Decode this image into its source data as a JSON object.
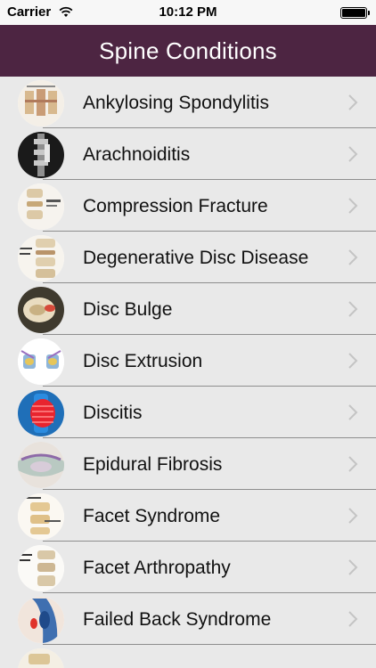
{
  "status_bar": {
    "carrier": "Carrier",
    "time": "10:12 PM",
    "icons": [
      "wifi-icon",
      "battery-icon"
    ]
  },
  "nav": {
    "title": "Spine Conditions",
    "background": "#4d2542"
  },
  "list": {
    "items": [
      {
        "label": "Ankylosing Spondylitis",
        "icon": "ankylosing-spondylitis-thumbnail"
      },
      {
        "label": "Arachnoiditis",
        "icon": "arachnoiditis-thumbnail"
      },
      {
        "label": "Compression Fracture",
        "icon": "compression-fracture-thumbnail"
      },
      {
        "label": "Degenerative Disc Disease",
        "icon": "degenerative-disc-disease-thumbnail"
      },
      {
        "label": "Disc Bulge",
        "icon": "disc-bulge-thumbnail"
      },
      {
        "label": "Disc Extrusion",
        "icon": "disc-extrusion-thumbnail"
      },
      {
        "label": "Discitis",
        "icon": "discitis-thumbnail"
      },
      {
        "label": "Epidural Fibrosis",
        "icon": "epidural-fibrosis-thumbnail"
      },
      {
        "label": "Facet Syndrome",
        "icon": "facet-syndrome-thumbnail"
      },
      {
        "label": "Facet Arthropathy",
        "icon": "facet-arthropathy-thumbnail"
      },
      {
        "label": "Failed Back Syndrome",
        "icon": "failed-back-syndrome-thumbnail"
      }
    ],
    "chevron_icon": "chevron-right-icon"
  }
}
